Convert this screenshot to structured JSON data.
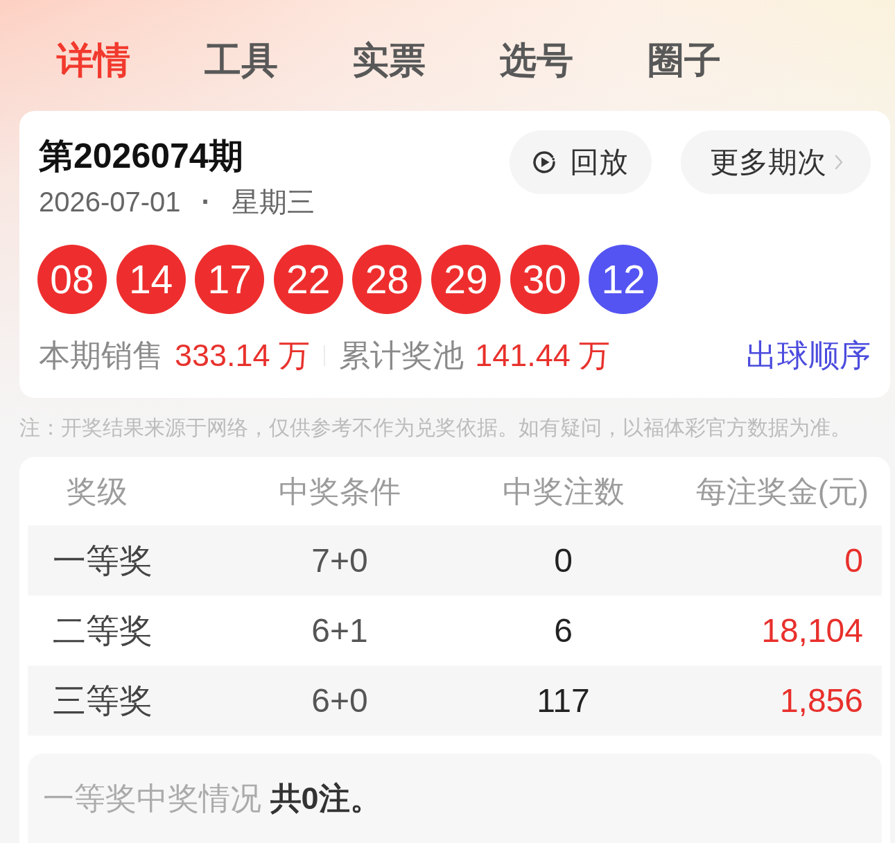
{
  "tabs": [
    {
      "label": "详情",
      "selected": true
    },
    {
      "label": "工具",
      "selected": false
    },
    {
      "label": "实票",
      "selected": false
    },
    {
      "label": "选号",
      "selected": false
    },
    {
      "label": "圈子",
      "selected": false
    }
  ],
  "draw": {
    "title": "第2026074期",
    "date": "2026-07-01",
    "separator": "·",
    "weekday": "星期三",
    "buttons": [
      {
        "kind": "replay",
        "label": "回放"
      },
      {
        "kind": "more",
        "label": "更多期次"
      }
    ],
    "balls": [
      {
        "number": "08",
        "color": "#ee2e2e"
      },
      {
        "number": "14",
        "color": "#ee2e2e"
      },
      {
        "number": "17",
        "color": "#ee2e2e"
      },
      {
        "number": "22",
        "color": "#ee2e2e"
      },
      {
        "number": "28",
        "color": "#ee2e2e"
      },
      {
        "number": "29",
        "color": "#ee2e2e"
      },
      {
        "number": "30",
        "color": "#ee2e2e"
      },
      {
        "number": "12",
        "color": "#5454f2"
      }
    ],
    "stats": [
      {
        "label": "本期销售",
        "value": "333.14 万"
      },
      {
        "label": "累计奖池",
        "value": "141.44 万"
      }
    ],
    "order_link": "出球顺序"
  },
  "note": "注：开奖结果来源于网络，仅供参考不作为兑奖依据。如有疑问，以福体彩官方数据为准。",
  "prize_table": {
    "columns": [
      "奖级",
      "中奖条件",
      "中奖注数",
      "每注奖金(元)"
    ],
    "rows": [
      {
        "level": "一等奖",
        "condition": "7+0",
        "count": "0",
        "prize": "0"
      },
      {
        "level": "二等奖",
        "condition": "6+1",
        "count": "6",
        "prize": "18,104"
      },
      {
        "level": "三等奖",
        "condition": "6+0",
        "count": "117",
        "prize": "1,856"
      }
    ]
  },
  "first_prize_summary": "一等奖中奖情况 **共0注。**"
}
